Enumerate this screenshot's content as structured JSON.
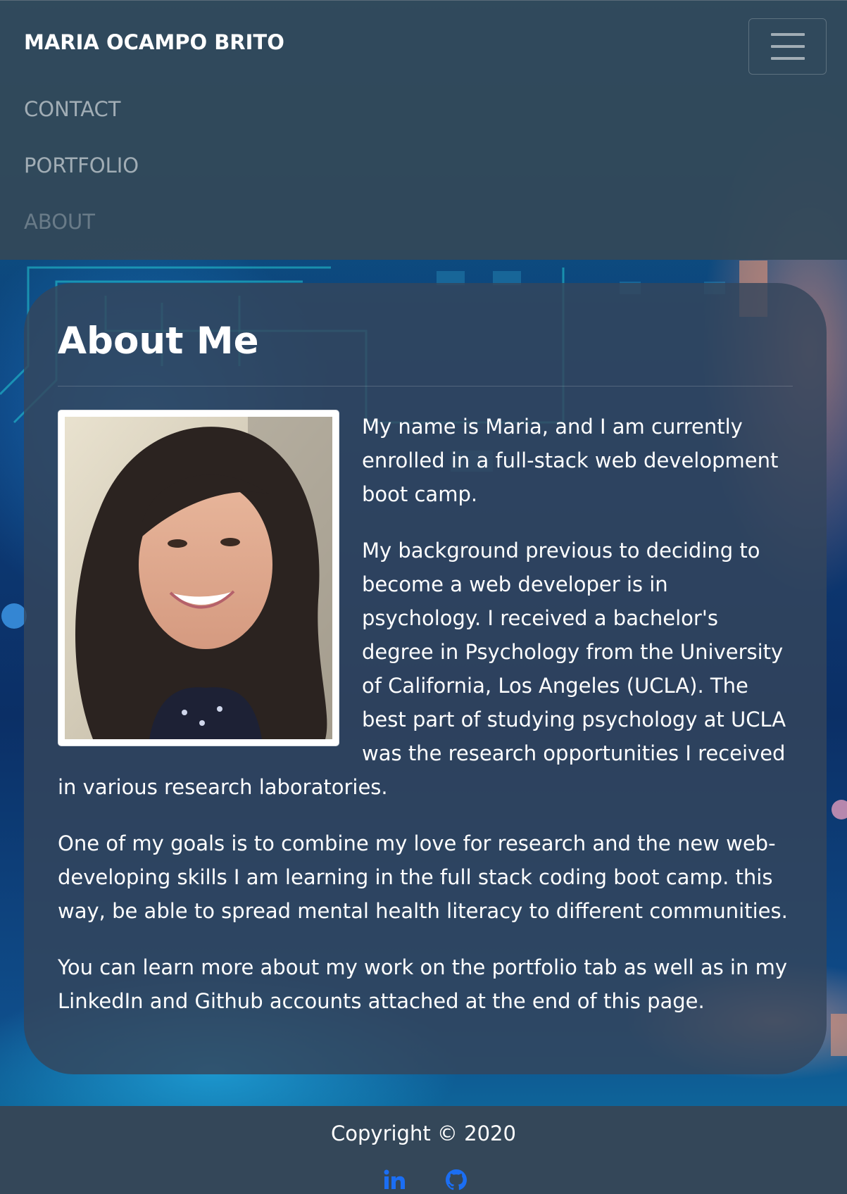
{
  "navbar": {
    "brand": "MARIA OCAMPO BRITO",
    "links": [
      {
        "label": "CONTACT"
      },
      {
        "label": "PORTFOLIO"
      },
      {
        "label": "ABOUT"
      }
    ],
    "active_link": "ABOUT"
  },
  "about": {
    "heading": "About Me",
    "paragraphs": [
      "My name is Maria, and I am currently enrolled in a full-stack web development boot camp.",
      "My background previous to deciding to become a web developer is in psychology. I received a bachelor's degree in Psychology from the University of California, Los Angeles (UCLA). The best part of studying psychology at UCLA was the research opportunities I received in various research laboratories.",
      "One of my goals is to combine my love for research and the new web-developing skills I am learning in the full stack coding boot camp. this way, be able to spread mental health literacy to different communities.",
      "You can learn more about my work on the portfolio tab as well as in my LinkedIn and Github accounts attached at the end of this page."
    ]
  },
  "footer": {
    "copyright": "Copyright © 2020",
    "social_icons": [
      "linkedin-icon",
      "github-icon"
    ]
  },
  "colors": {
    "navbar_bg": "#344858",
    "card_bg": "#34465c",
    "footer_bg": "#344759",
    "social_link": "#1b6ef3"
  }
}
